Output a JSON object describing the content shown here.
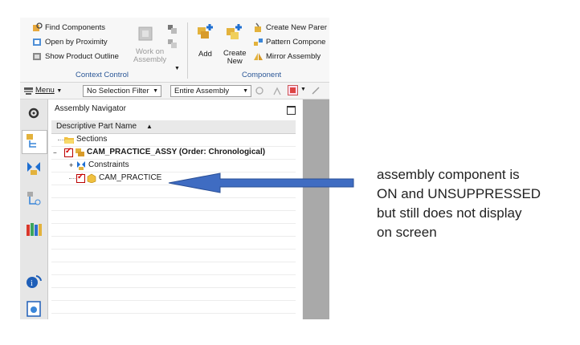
{
  "ribbon": {
    "find_components": "Find Components",
    "open_by_proximity": "Open by Proximity",
    "show_product_outline": "Show Product Outline",
    "work_on_assembly": [
      "Work on",
      "Assembly"
    ],
    "context_control": "Context Control",
    "add": "Add",
    "create_new": [
      "Create",
      "New"
    ],
    "create_new_parent": "Create New Parer",
    "pattern_component": "Pattern Compone",
    "mirror_assembly": "Mirror Assembly",
    "component": "Component"
  },
  "toolbar": {
    "menu": "Menu",
    "selection_filter": "No Selection Filter",
    "scope": "Entire Assembly"
  },
  "navigator": {
    "title": "Assembly Navigator",
    "column_header": "Descriptive Part Name",
    "rows": {
      "sections": "Sections",
      "assy": "CAM_PRACTICE_ASSY (Order: Chronological)",
      "constraints": "Constraints",
      "part": "CAM_PRACTICE"
    }
  },
  "annotation": {
    "lines": [
      "assembly component is",
      "ON and UNSUPPRESSED",
      "but still does not display",
      "on screen"
    ]
  },
  "colors": {
    "arrow": "#3f6cc2",
    "checkbox": "#d40000",
    "folder": "#f0c040"
  }
}
